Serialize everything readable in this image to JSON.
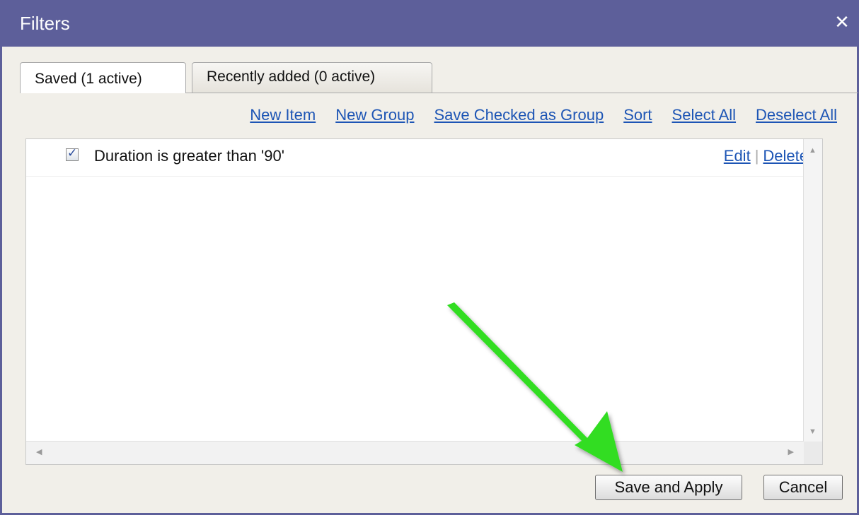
{
  "dialog": {
    "title": "Filters",
    "close_symbol": "✕"
  },
  "tabs": [
    {
      "label": "Saved (1 active)",
      "active": true
    },
    {
      "label": "Recently added (0 active)",
      "active": false
    }
  ],
  "toolbar": {
    "new_item": "New Item",
    "new_group": "New Group",
    "save_checked": "Save Checked as Group",
    "sort": "Sort",
    "select_all": "Select All",
    "deselect_all": "Deselect All"
  },
  "filters": [
    {
      "label": "Duration is greater than '90'",
      "checked": true,
      "edit": "Edit",
      "separator": "|",
      "delete": "Delete"
    }
  ],
  "buttons": {
    "save_apply": "Save and Apply",
    "cancel": "Cancel"
  },
  "colors": {
    "titlebar": "#5d5f9a",
    "link": "#1d55b5",
    "arrow": "#33dd22"
  },
  "annotation": {
    "icon": "green-arrow-icon",
    "points_to": "save-and-apply-button"
  }
}
